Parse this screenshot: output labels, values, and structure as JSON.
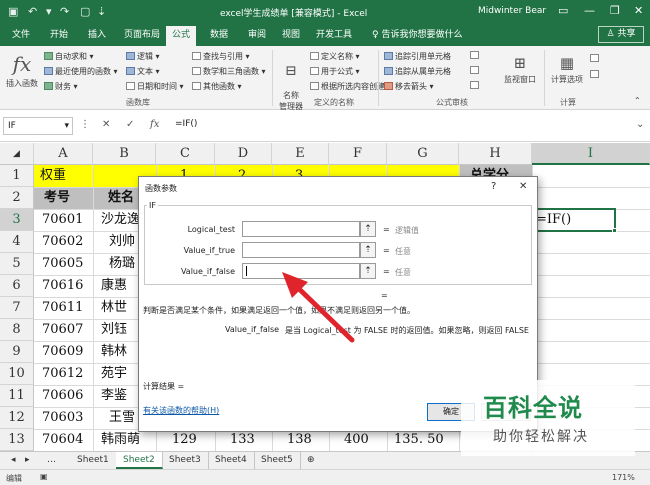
{
  "window": {
    "title": "excel学生成绩单  [兼容模式] - Excel",
    "user": "Midwinter Bear",
    "share_label": "共享",
    "tell_me": "告诉我你想要做什么"
  },
  "tabs": [
    "文件",
    "开始",
    "插入",
    "页面布局",
    "公式",
    "数据",
    "审阅",
    "视图",
    "开发工具"
  ],
  "active_tab": "公式",
  "ribbon": {
    "insert_function": "插入函数",
    "lib_items": [
      "自动求和",
      "最近使用的函数",
      "财务",
      "逻辑",
      "文本",
      "日期和时间",
      "查找与引用",
      "数学和三角函数",
      "其他函数"
    ],
    "lib_group": "函数库",
    "name_manager": "名称\n管理器",
    "name_items": [
      "定义名称",
      "用于公式",
      "根据所选内容创建"
    ],
    "name_group": "定义的名称",
    "audit_items": [
      "追踪引用单元格",
      "追踪从属单元格",
      "移去箭头"
    ],
    "watch_window": "监视窗口",
    "audit_group": "公式审核",
    "calc_options": "计算选项",
    "calc_group": "计算"
  },
  "formula_bar": {
    "name_box": "IF",
    "formula": "=IF()"
  },
  "grid": {
    "columns": [
      "A",
      "B",
      "C",
      "D",
      "E",
      "F",
      "G",
      "H",
      "I"
    ],
    "rows": [
      "1",
      "2",
      "3",
      "4",
      "5",
      "6",
      "7",
      "8",
      "9",
      "10",
      "11",
      "12",
      "13"
    ],
    "active_cell": "I3",
    "row1": {
      "a": "权重",
      "c": "1",
      "d": "2",
      "e": "3",
      "h": "总学分"
    },
    "row2": {
      "a": "考号",
      "b": "姓名"
    },
    "ids": [
      "70601",
      "70602",
      "70605",
      "70616",
      "70611",
      "70607",
      "70609",
      "70612",
      "70606",
      "70603",
      "70604"
    ],
    "names": [
      "沙龙逸",
      "刘帅",
      "杨璐",
      "康惠",
      "林世",
      "刘钰",
      "韩林",
      "苑宇",
      "李鉴",
      "王雪",
      "韩雨萌"
    ],
    "row13": {
      "c": "129",
      "d": "133",
      "e": "138",
      "f": "400",
      "g": "135. 50"
    },
    "i3": "=IF()"
  },
  "sheets": [
    "Sheet1",
    "Sheet2",
    "Sheet3",
    "Sheet4",
    "Sheet5"
  ],
  "active_sheet": "Sheet2",
  "status": {
    "mode": "编辑",
    "zoom": "171%"
  },
  "dialog": {
    "title": "函数参数",
    "function_name": "IF",
    "args": [
      {
        "label": "Logical_test",
        "hint": "逻辑值"
      },
      {
        "label": "Value_if_true",
        "hint": "任意"
      },
      {
        "label": "Value_if_false",
        "hint": "任意"
      }
    ],
    "result_eq": "=",
    "description": "判断是否满足某个条件，如果满足返回一个值，如果不满足则返回另一个值。",
    "param_name": "Value_if_false",
    "param_desc": "是当 Logical_test 为 FALSE 时的返回值。如果忽略，则返回 FALSE",
    "calc_result": "计算结果 =",
    "help_link": "有关该函数的帮助(H)",
    "ok": "确定",
    "help_char": "?",
    "close_char": "✕"
  },
  "watermark": {
    "logo": "百科全说",
    "sub": "助你轻松解决"
  },
  "colors": {
    "excel_green": "#217346",
    "highlight_yellow": "#ffff00",
    "header_gray": "#bfbfbf",
    "arrow_red": "#e0242b"
  }
}
